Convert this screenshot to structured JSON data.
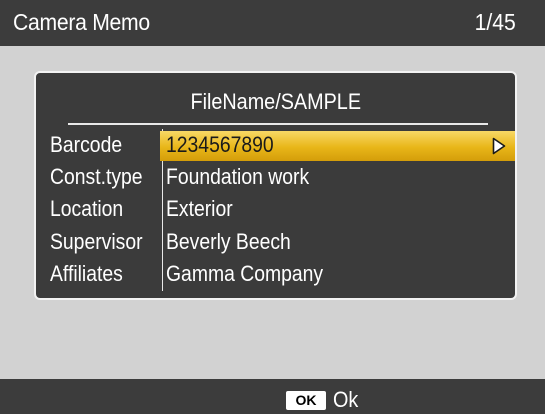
{
  "header": {
    "title": "Camera Memo",
    "page_counter": "1/45"
  },
  "memo": {
    "file_name": "FileName/SAMPLE",
    "rows": [
      {
        "label": "Barcode",
        "value": "1234567890",
        "selected": true
      },
      {
        "label": "Const.type",
        "value": "Foundation work",
        "selected": false
      },
      {
        "label": "Location",
        "value": "Exterior",
        "selected": false
      },
      {
        "label": "Supervisor",
        "value": "Beverly Beech",
        "selected": false
      },
      {
        "label": "Affiliates",
        "value": "Gamma Company",
        "selected": false
      }
    ],
    "selected_row_icon": "right-triangle-arrow-icon"
  },
  "footer": {
    "ok_key": "OK",
    "ok_label": "Ok"
  },
  "colors": {
    "background": "#d2d2d2",
    "bars": "#3c3c3c",
    "panel": "#3b3b3b",
    "highlight": "#e8b618"
  }
}
